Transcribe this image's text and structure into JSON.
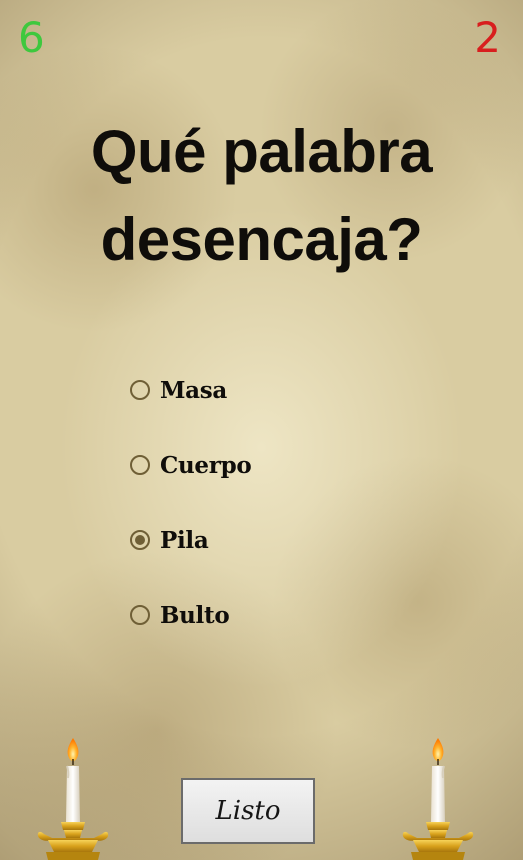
{
  "score": {
    "correct": "6",
    "wrong": "2",
    "correct_color": "#3ec83e",
    "wrong_color": "#d81e1e"
  },
  "question": {
    "line1": "Qué palabra",
    "line2": "desencaja?"
  },
  "options": [
    {
      "label": "Masa",
      "selected": false
    },
    {
      "label": "Cuerpo",
      "selected": false
    },
    {
      "label": "Pila",
      "selected": true
    },
    {
      "label": "Bulto",
      "selected": false
    }
  ],
  "submit_button": {
    "label": "Listo"
  },
  "decorations": {
    "left": "candle-icon",
    "right": "candle-icon"
  }
}
